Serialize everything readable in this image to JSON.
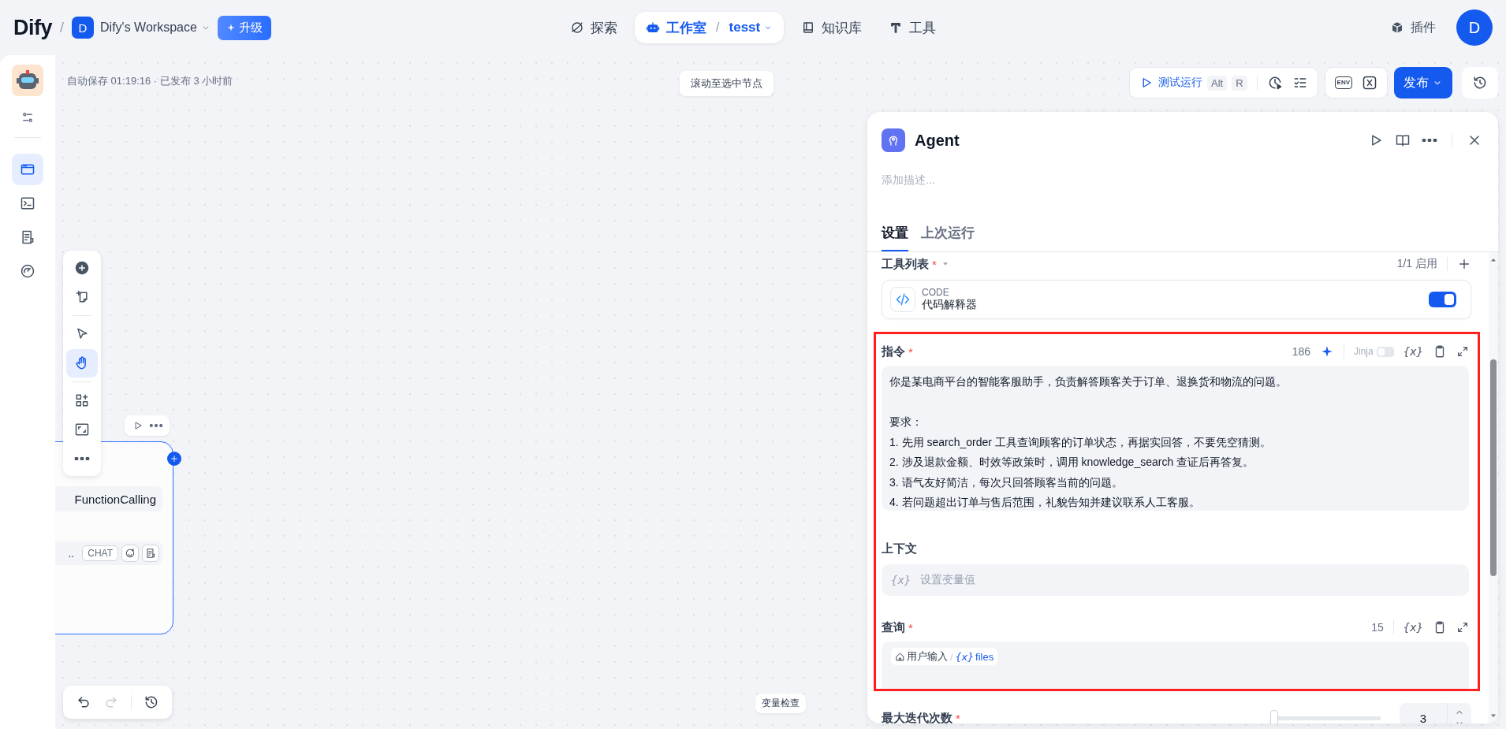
{
  "header": {
    "logo": "Dify",
    "logo_separator": "/",
    "workspace": {
      "initial": "D",
      "name": "Dify's Workspace"
    },
    "upgrade": "升级",
    "nav": [
      {
        "label": "探索",
        "selected": false
      },
      {
        "label": "工作室",
        "selected": true,
        "separator": "/",
        "app": "tesst"
      },
      {
        "label": "知识库",
        "selected": false
      },
      {
        "label": "工具",
        "selected": false
      }
    ],
    "plugins": "插件",
    "avatar": "D"
  },
  "sidebar": {
    "items": [
      {
        "selected": true
      },
      {
        "selected": false
      },
      {
        "selected": false
      },
      {
        "selected": false
      }
    ]
  },
  "canvas": {
    "status": "自动保存 01:19:16 · 已发布 3 小时前",
    "scroll_hint": "滚动至选中节点",
    "variable_check": "变量检查",
    "test_run": {
      "label": "测试运行",
      "keys": [
        "Alt",
        "R"
      ]
    },
    "env": "ENV",
    "publish": "发布",
    "tools": [
      {
        "selected": false
      },
      {
        "selected": false
      },
      {
        "selected": false
      },
      {
        "selected": true
      },
      {
        "selected": false
      },
      {
        "selected": false
      },
      {
        "selected": false
      }
    ],
    "node": {
      "model": "FunctionCalling",
      "truncated": "..",
      "badge": "CHAT"
    },
    "history": {
      "undo_disabled": false,
      "redo_disabled": true
    }
  },
  "panel": {
    "title": "Agent",
    "description_placeholder": "添加描述...",
    "tabs": [
      {
        "label": "设置",
        "selected": true
      },
      {
        "label": "上次运行",
        "selected": false
      }
    ],
    "tools": {
      "label": "工具列表",
      "mark": "*",
      "count": "1/1 启用",
      "items": [
        {
          "provider": "CODE",
          "name": "代码解释器",
          "enabled": true
        }
      ]
    },
    "instruction": {
      "label": "指令",
      "mark": "*",
      "count": "186",
      "jinja": {
        "label": "Jinja",
        "on": false
      },
      "var_icon": "{x}",
      "paragraphs": [
        [
          "你是某电商平台的智能客服助手，负责解答顾客关于订单、退换货和物流的问题。"
        ],
        [
          "要求：",
          "1. 先用 search_order 工具查询顾客的订单状态，再据实回答，不要凭空猜测。",
          "2. 涉及退款金额、时效等政策时，调用 knowledge_search 查证后再答复。",
          "3. 语气友好简洁，每次只回答顾客当前的问题。",
          "4. 若问题超出订单与售后范围，礼貌告知并建议联系人工客服。"
        ]
      ]
    },
    "context": {
      "label": "上下文",
      "var_icon": "{x}",
      "placeholder": "设置变量值"
    },
    "query": {
      "label": "查询",
      "mark": "*",
      "count": "15",
      "var_icon": "{x}",
      "tag": {
        "source": "用户输入",
        "separator": "/",
        "var_icon": "{x}",
        "name": "files"
      }
    },
    "max_iterations": {
      "label": "最大迭代次数",
      "mark": "*",
      "level": 0,
      "value": "3"
    }
  }
}
